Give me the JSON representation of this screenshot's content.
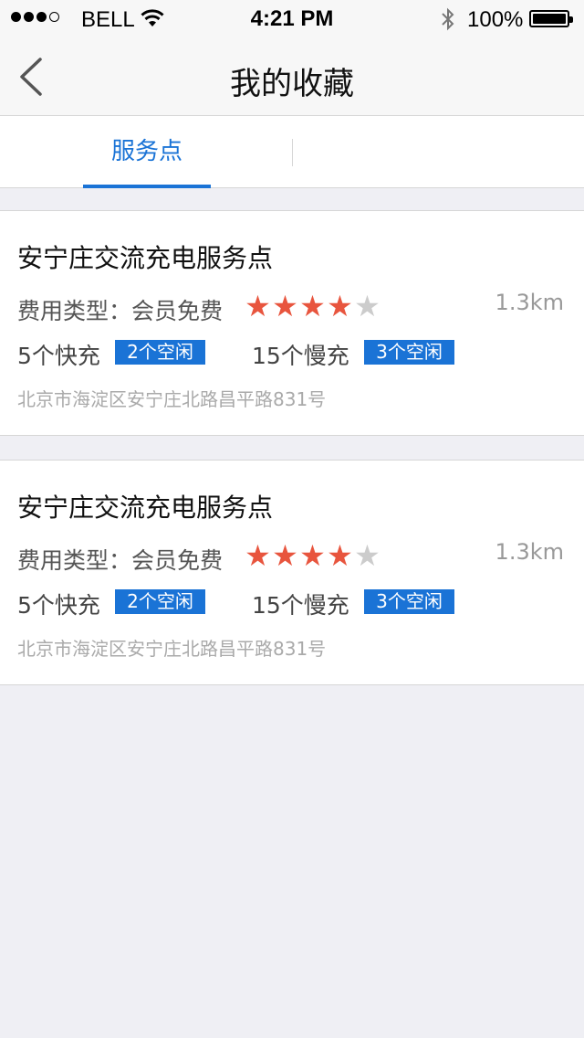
{
  "status_bar": {
    "carrier": "BELL",
    "time": "4:21 PM",
    "battery": "100%"
  },
  "nav": {
    "title": "我的收藏"
  },
  "tabs": [
    {
      "label": "服务点",
      "active": true
    }
  ],
  "colors": {
    "accent": "#1a73d6",
    "star_filled": "#e8553e",
    "star_empty": "#cccccc"
  },
  "stations": [
    {
      "name": "安宁庄交流充电服务点",
      "fee_type": "费用类型：会员免费",
      "rating": 4,
      "rating_max": 5,
      "distance": "1.3km",
      "fast_count": "5个快充",
      "fast_free": "2个空闲",
      "slow_count": "15个慢充",
      "slow_free": "3个空闲",
      "address": "北京市海淀区安宁庄北路昌平路831号"
    },
    {
      "name": "安宁庄交流充电服务点",
      "fee_type": "费用类型：会员免费",
      "rating": 4,
      "rating_max": 5,
      "distance": "1.3km",
      "fast_count": "5个快充",
      "fast_free": "2个空闲",
      "slow_count": "15个慢充",
      "slow_free": "3个空闲",
      "address": "北京市海淀区安宁庄北路昌平路831号"
    }
  ]
}
